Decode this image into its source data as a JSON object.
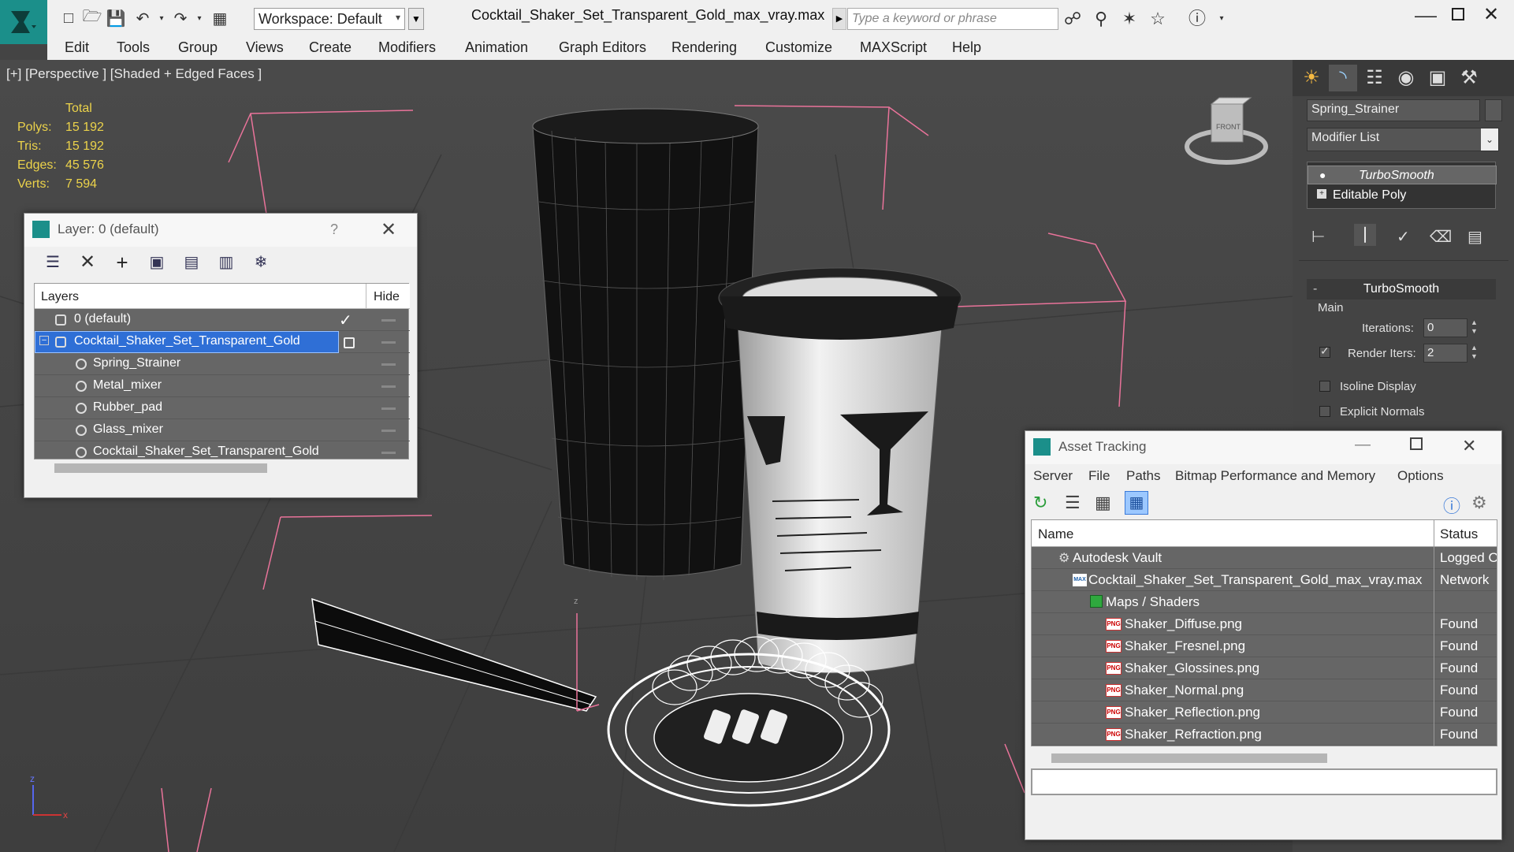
{
  "titlebar": {
    "workspace": "Workspace: Default",
    "document_title": "Cocktail_Shaker_Set_Transparent_Gold_max_vray.max",
    "search_placeholder": "Type a keyword or phrase"
  },
  "menu": [
    "Edit",
    "Tools",
    "Group",
    "Views",
    "Create",
    "Modifiers",
    "Animation",
    "Graph Editors",
    "Rendering",
    "Customize",
    "MAXScript",
    "Help"
  ],
  "viewport": {
    "label": "[+] [Perspective ] [Shaded + Edged Faces ]",
    "stats": {
      "header": "Total",
      "rows": [
        {
          "key": "Polys:",
          "value": "15 192"
        },
        {
          "key": "Tris:",
          "value": "15 192"
        },
        {
          "key": "Edges:",
          "value": "45 576"
        },
        {
          "key": "Verts:",
          "value": "7 594"
        }
      ]
    },
    "viewcube_label": "FRONT",
    "axis_labels": {
      "z": "z",
      "x": "x"
    }
  },
  "layer_panel": {
    "title": "Layer: 0 (default)",
    "help": "?",
    "columns": {
      "layers": "Layers",
      "hide": "Hide"
    },
    "rows": [
      {
        "name": "0 (default)"
      },
      {
        "name": "Cocktail_Shaker_Set_Transparent_Gold"
      },
      {
        "name": "Spring_Strainer"
      },
      {
        "name": "Metal_mixer"
      },
      {
        "name": "Rubber_pad"
      },
      {
        "name": "Glass_mixer"
      },
      {
        "name": "Cocktail_Shaker_Set_Transparent_Gold"
      }
    ]
  },
  "command_panel": {
    "object_name": "Spring_Strainer",
    "modifier_list": "Modifier List",
    "stack": [
      "TurboSmooth",
      "Editable Poly"
    ],
    "rollout_title": "TurboSmooth",
    "group_main": "Main",
    "iterations_label": "Iterations:",
    "iterations_value": "0",
    "render_iters_label": "Render Iters:",
    "render_iters_value": "2",
    "isoline_label": "Isoline Display",
    "explicit_normals_label": "Explicit Normals"
  },
  "asset_tracking": {
    "title": "Asset Tracking",
    "menu": [
      "Server",
      "File",
      "Paths",
      "Bitmap Performance and Memory",
      "Options"
    ],
    "columns": {
      "name": "Name",
      "status": "Status"
    },
    "rows": [
      {
        "name": "Autodesk Vault",
        "status": "Logged O"
      },
      {
        "name": "Cocktail_Shaker_Set_Transparent_Gold_max_vray.max",
        "status": "Network"
      },
      {
        "name": "Maps / Shaders",
        "status": ""
      },
      {
        "name": "Shaker_Diffuse.png",
        "status": "Found"
      },
      {
        "name": "Shaker_Fresnel.png",
        "status": "Found"
      },
      {
        "name": "Shaker_Glossines.png",
        "status": "Found"
      },
      {
        "name": "Shaker_Normal.png",
        "status": "Found"
      },
      {
        "name": "Shaker_Reflection.png",
        "status": "Found"
      },
      {
        "name": "Shaker_Refraction.png",
        "status": "Found"
      }
    ]
  },
  "colors": {
    "accent": "#1b8f8a",
    "selection": "#2f6fd6",
    "stats_yellow": "#ecd34a",
    "gizmo_pink": "#e9739a"
  }
}
